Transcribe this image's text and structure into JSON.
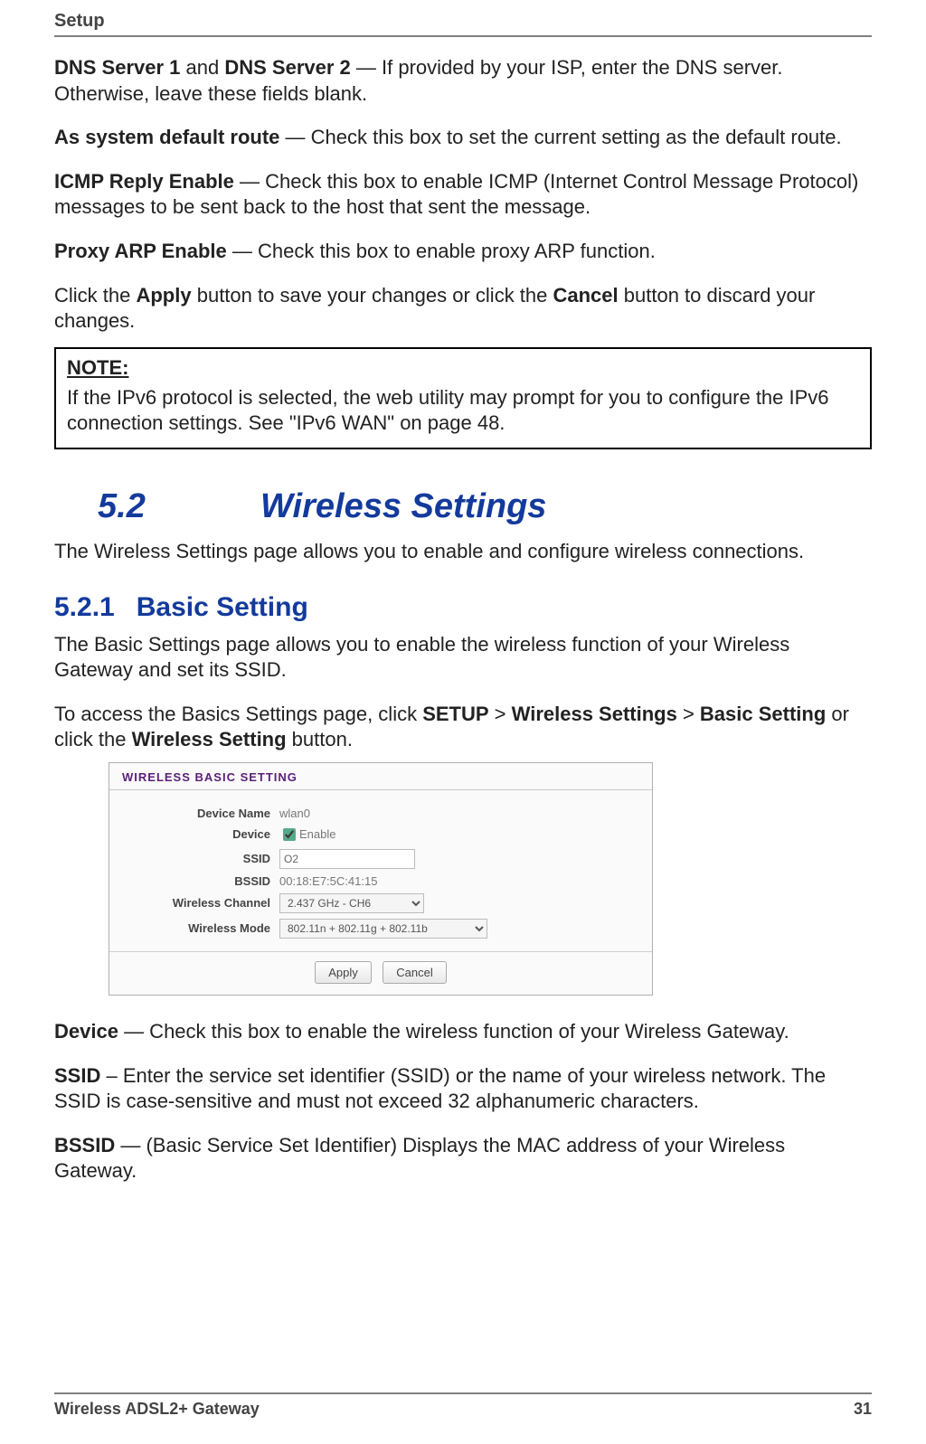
{
  "header": {
    "breadcrumb": "Setup"
  },
  "paragraphs": {
    "dns_bold1": "DNS Server 1",
    "dns_and": " and ",
    "dns_bold2": "DNS Server 2",
    "dns_rest": " — If provided by your ISP, enter the DNS server. Otherwise, leave these fields blank.",
    "defroute_bold": "As system default route",
    "defroute_rest": " — Check this box to set the current setting as the default route.",
    "icmp_bold": "ICMP Reply Enable",
    "icmp_rest": " — Check this box to enable ICMP (Internet Control Message Protocol) messages to be sent back to the host that sent the message.",
    "proxy_bold": "Proxy ARP Enable",
    "proxy_rest": " — Check this box to enable proxy ARP function.",
    "apply1": "Click the ",
    "apply_b1": "Apply",
    "apply2": " button to save your changes or click the ",
    "apply_b2": "Cancel",
    "apply3": " button to discard your changes."
  },
  "note": {
    "title": "NOTE:",
    "body": "If the IPv6 protocol is selected, the web utility may prompt for you to configure the IPv6 connection settings. See \"IPv6 WAN\" on page 48."
  },
  "section52": {
    "num": "5.2",
    "title": "Wireless Settings"
  },
  "section52_intro": "The Wireless Settings page allows you to enable and configure wireless connections.",
  "section521": {
    "num": "5.2.1",
    "title": "Basic Setting"
  },
  "section521_p1": "The Basic Settings page allows you to enable the wireless function of your Wireless Gateway and set its SSID.",
  "section521_p2a": "To access the Basics Settings page, click ",
  "section521_setup": "SETUP",
  "section521_gt1": " > ",
  "section521_ws": "Wireless Settings",
  "section521_gt2": " > ",
  "section521_bs": "Basic Setting",
  "section521_p2b": " or click the ",
  "section521_wsbtn": "Wireless Setting",
  "section521_p2c": " button.",
  "screenshot": {
    "title": "WIRELESS BASIC SETTING",
    "rows": {
      "device_name_label": "Device Name",
      "device_name_value": "wlan0",
      "device_label": "Device",
      "device_enable": "Enable",
      "ssid_label": "SSID",
      "ssid_value": "O2",
      "bssid_label": "BSSID",
      "bssid_value": "00:18:E7:5C:41:15",
      "channel_label": "Wireless Channel",
      "channel_value": "2.437 GHz - CH6",
      "mode_label": "Wireless Mode",
      "mode_value": "802.11n + 802.11g + 802.11b"
    },
    "apply": "Apply",
    "cancel": "Cancel"
  },
  "after_ss": {
    "device_b": "Device",
    "device_rest": " — Check this box to enable the wireless function of your Wireless Gateway.",
    "ssid_b": "SSID",
    "ssid_rest": " – Enter the service set identifier (SSID) or the name of your wireless network. The SSID is case-sensitive and must not exceed 32 alphanumeric characters.",
    "bssid_b": "BSSID",
    "bssid_rest": " — (Basic Service Set Identifier) Displays the MAC address of your Wireless Gateway."
  },
  "footer": {
    "left": "Wireless ADSL2+ Gateway",
    "right": "31"
  }
}
